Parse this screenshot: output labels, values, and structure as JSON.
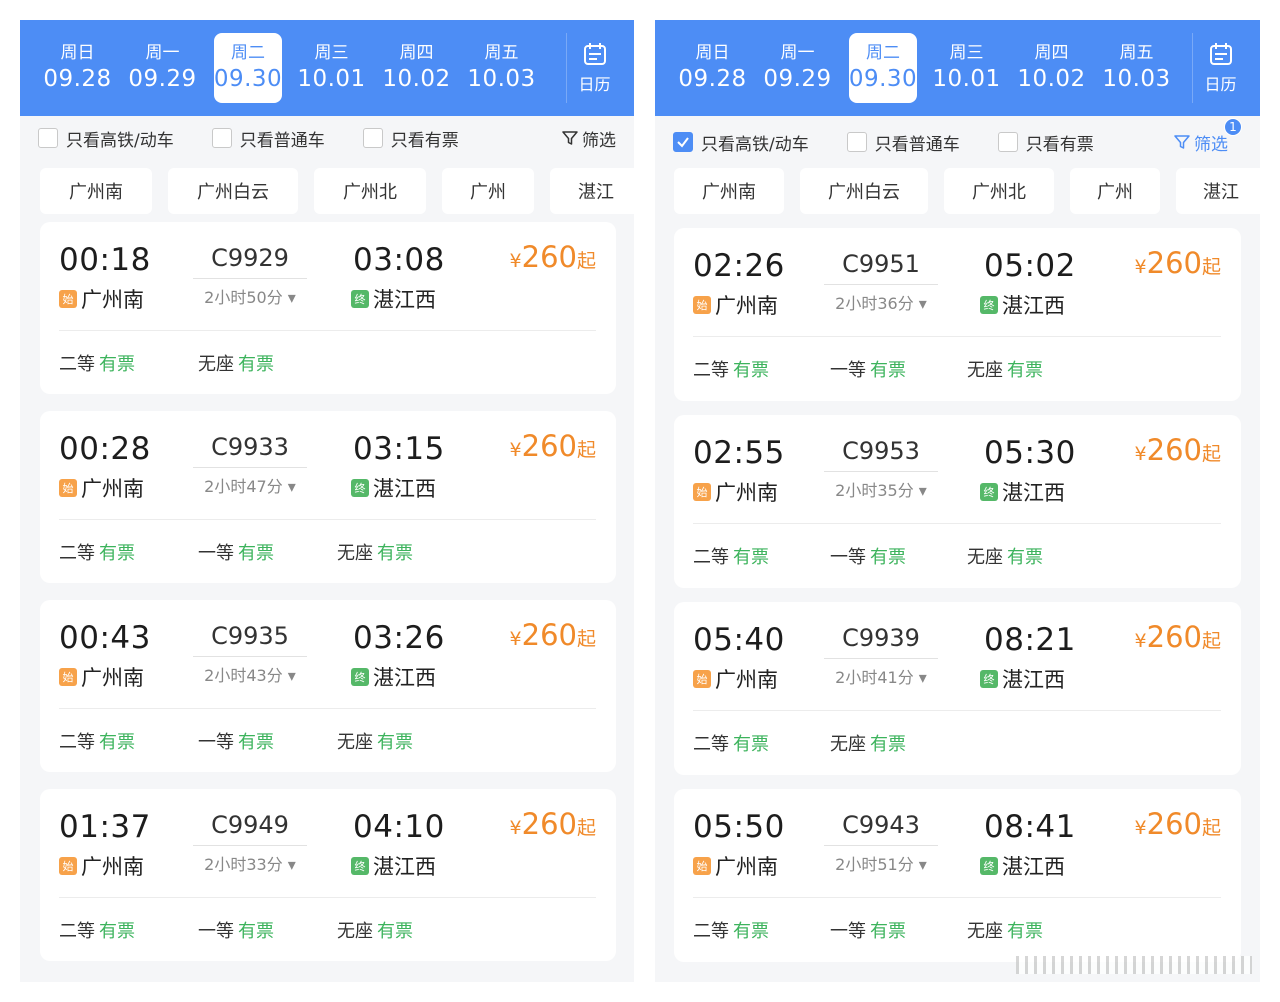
{
  "left": {
    "dates": [
      {
        "weekday": "周日",
        "date": "09.28"
      },
      {
        "weekday": "周一",
        "date": "09.29"
      },
      {
        "weekday": "周二",
        "date": "09.30"
      },
      {
        "weekday": "周三",
        "date": "10.01"
      },
      {
        "weekday": "周四",
        "date": "10.02"
      },
      {
        "weekday": "周五",
        "date": "10.03"
      }
    ],
    "calendar_label": "日历",
    "filters": {
      "high_speed": "只看高铁/动车",
      "normal": "只看普通车",
      "available": "只看有票",
      "filter_btn": "筛选"
    },
    "stations": [
      "广州南",
      "广州白云",
      "广州北",
      "广州",
      "湛江"
    ],
    "trains": [
      {
        "dep_time": "00:18",
        "train_no": "C9929",
        "duration": "2小时50分",
        "arr_time": "03:08",
        "dep_station": "广州南",
        "arr_station": "湛江西",
        "price": "260",
        "seats": [
          {
            "name": "二等",
            "status": "有票"
          },
          {
            "name": "无座",
            "status": "有票"
          }
        ]
      },
      {
        "dep_time": "00:28",
        "train_no": "C9933",
        "duration": "2小时47分",
        "arr_time": "03:15",
        "dep_station": "广州南",
        "arr_station": "湛江西",
        "price": "260",
        "seats": [
          {
            "name": "二等",
            "status": "有票"
          },
          {
            "name": "一等",
            "status": "有票"
          },
          {
            "name": "无座",
            "status": "有票"
          }
        ]
      },
      {
        "dep_time": "00:43",
        "train_no": "C9935",
        "duration": "2小时43分",
        "arr_time": "03:26",
        "dep_station": "广州南",
        "arr_station": "湛江西",
        "price": "260",
        "seats": [
          {
            "name": "二等",
            "status": "有票"
          },
          {
            "name": "一等",
            "status": "有票"
          },
          {
            "name": "无座",
            "status": "有票"
          }
        ]
      },
      {
        "dep_time": "01:37",
        "train_no": "C9949",
        "duration": "2小时33分",
        "arr_time": "04:10",
        "dep_station": "广州南",
        "arr_station": "湛江西",
        "price": "260",
        "seats": [
          {
            "name": "二等",
            "status": "有票"
          },
          {
            "name": "一等",
            "status": "有票"
          },
          {
            "name": "无座",
            "status": "有票"
          }
        ]
      }
    ]
  },
  "right": {
    "dates": [
      {
        "weekday": "周日",
        "date": "09.28"
      },
      {
        "weekday": "周一",
        "date": "09.29"
      },
      {
        "weekday": "周二",
        "date": "09.30"
      },
      {
        "weekday": "周三",
        "date": "10.01"
      },
      {
        "weekday": "周四",
        "date": "10.02"
      },
      {
        "weekday": "周五",
        "date": "10.03"
      }
    ],
    "calendar_label": "日历",
    "filters": {
      "high_speed": "只看高铁/动车",
      "normal": "只看普通车",
      "available": "只看有票",
      "filter_btn": "筛选",
      "filter_count": "1"
    },
    "stations": [
      "广州南",
      "广州白云",
      "广州北",
      "广州",
      "湛江"
    ],
    "trains": [
      {
        "dep_time": "02:26",
        "train_no": "C9951",
        "duration": "2小时36分",
        "arr_time": "05:02",
        "dep_station": "广州南",
        "arr_station": "湛江西",
        "price": "260",
        "seats": [
          {
            "name": "二等",
            "status": "有票"
          },
          {
            "name": "一等",
            "status": "有票"
          },
          {
            "name": "无座",
            "status": "有票"
          }
        ]
      },
      {
        "dep_time": "02:55",
        "train_no": "C9953",
        "duration": "2小时35分",
        "arr_time": "05:30",
        "dep_station": "广州南",
        "arr_station": "湛江西",
        "price": "260",
        "seats": [
          {
            "name": "二等",
            "status": "有票"
          },
          {
            "name": "一等",
            "status": "有票"
          },
          {
            "name": "无座",
            "status": "有票"
          }
        ]
      },
      {
        "dep_time": "05:40",
        "train_no": "C9939",
        "duration": "2小时41分",
        "arr_time": "08:21",
        "dep_station": "广州南",
        "arr_station": "湛江西",
        "price": "260",
        "seats": [
          {
            "name": "二等",
            "status": "有票"
          },
          {
            "name": "无座",
            "status": "有票"
          }
        ]
      },
      {
        "dep_time": "05:50",
        "train_no": "C9943",
        "duration": "2小时51分",
        "arr_time": "08:41",
        "dep_station": "广州南",
        "arr_station": "湛江西",
        "price": "260",
        "seats": [
          {
            "name": "二等",
            "status": "有票"
          },
          {
            "name": "一等",
            "status": "有票"
          },
          {
            "name": "无座",
            "status": "有票"
          }
        ]
      }
    ]
  },
  "common": {
    "currency": "¥",
    "from_suffix": "起",
    "start_tag": "始",
    "end_tag": "终"
  },
  "colors": {
    "brand": "#4d8df5",
    "price": "#f08a2a",
    "available": "#3cb35c"
  }
}
